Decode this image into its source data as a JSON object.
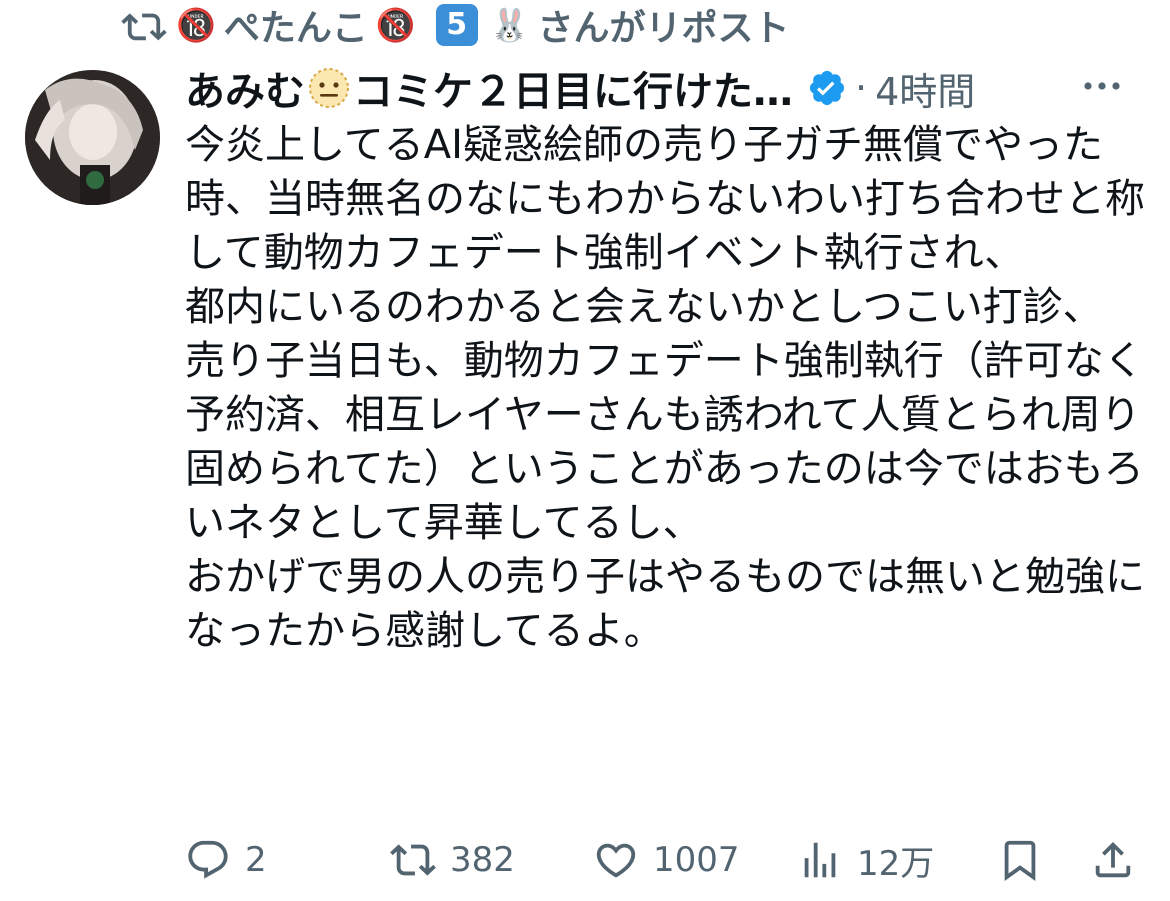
{
  "repost_header": {
    "emoji_before": "🔞",
    "user_name": "ぺたんこ",
    "emoji_after": "🔞",
    "keycap": "5",
    "rabbit": "🐰",
    "suffix": "さんがリポスト"
  },
  "tweet": {
    "display_name_part1": "あみむ",
    "display_name_part2": "コミケ２日目に行けた…",
    "separator": "·",
    "time": "4時間",
    "text": "今炎上してるAI疑惑絵師の売り子ガチ無償でやった時、当時無名のなにもわからないわい打ち合わせと称して動物カフェデート強制イベント執行され、\n都内にいるのわかると会えないかとしつこい打診、\n売り子当日も、動物カフェデート強制執行（許可なく予約済、相互レイヤーさんも誘われて人質とられ周り固められてた）ということがあったのは今ではおもろいネタとして昇華してるし、\nおかげで男の人の売り子はやるものでは無いと勉強になったから感謝してるよ。"
  },
  "actions": {
    "reply_count": "2",
    "repost_count": "382",
    "like_count": "1007",
    "view_count": "12万"
  },
  "icons": {
    "reply": "speech-bubble-icon",
    "repost": "repost-icon",
    "like": "heart-icon",
    "views": "bar-chart-icon",
    "bookmark": "bookmark-icon",
    "share": "share-icon",
    "more": "more-dots-icon",
    "verified": "verified-badge-icon"
  },
  "colors": {
    "text_primary": "#0f1419",
    "text_secondary": "#536471",
    "verified_blue": "#1d9bf0"
  }
}
